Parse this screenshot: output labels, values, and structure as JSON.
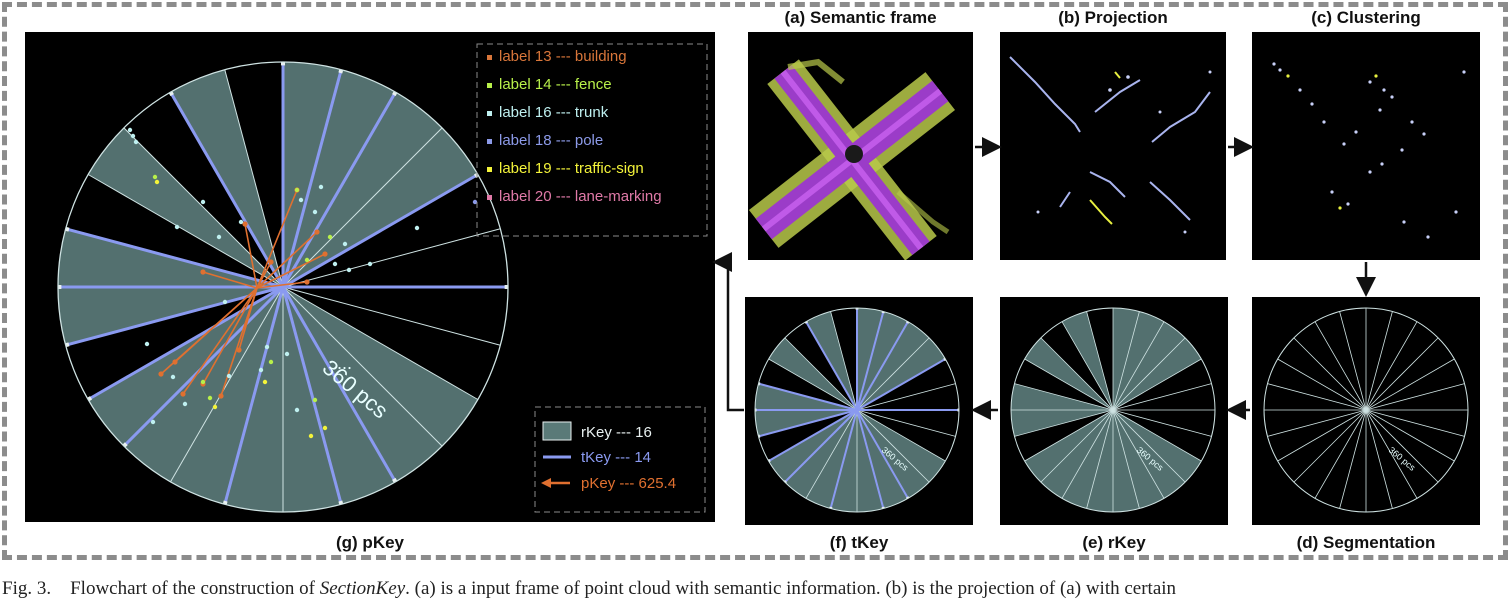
{
  "panels": {
    "a": {
      "label": "(a) Semantic frame"
    },
    "b": {
      "label": "(b) Projection"
    },
    "c": {
      "label": "(c) Clustering"
    },
    "d": {
      "label": "(d) Segmentation",
      "pcs": "360 pcs"
    },
    "e": {
      "label": "(e) rKey",
      "pcs": "360 pcs"
    },
    "f": {
      "label": "(f) tKey",
      "pcs": "360 pcs"
    },
    "g": {
      "label": "(g) pKey",
      "pcs": "360 pcs",
      "dots": "..."
    }
  },
  "legend_labels": [
    {
      "text": "label 13 --- building",
      "color": "#d9763a"
    },
    {
      "text": "label 14 --- fence",
      "color": "#b8f04a"
    },
    {
      "text": "label 16 --- trunk",
      "color": "#bff0f0"
    },
    {
      "text": "label 18 --- pole",
      "color": "#8c9ae8"
    },
    {
      "text": "label 19 --- traffic-sign",
      "color": "#f4f43a"
    },
    {
      "text": "label 20 --- lane-marking",
      "color": "#e07aa8"
    }
  ],
  "legend_keys": [
    {
      "text": "rKey --- 16",
      "color": "#e8f0f0"
    },
    {
      "text": "tKey --- 14",
      "color": "#8a9af0"
    },
    {
      "text": "pKey --- 625.4",
      "color": "#e07030"
    }
  ],
  "caption": {
    "prefix": "Fig. 3.",
    "text1": "Flowchart of the construction of ",
    "italic": "SectionKey",
    "text2": ". (a) is a input frame of point cloud with semantic information. (b) is the projection of (a) with certain"
  }
}
